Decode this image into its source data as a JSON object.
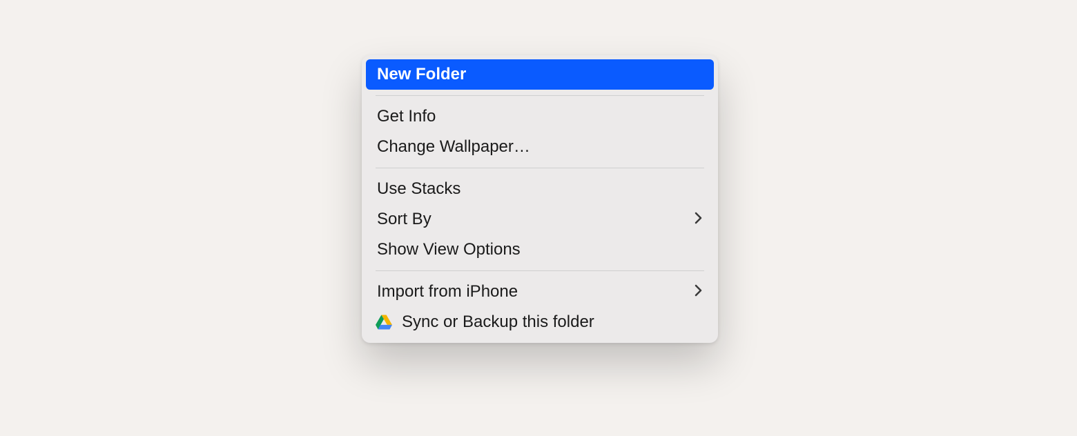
{
  "menu": {
    "items": [
      {
        "label": "New Folder"
      },
      {
        "label": "Get Info"
      },
      {
        "label": "Change Wallpaper…"
      },
      {
        "label": "Use Stacks"
      },
      {
        "label": "Sort By"
      },
      {
        "label": "Show View Options"
      },
      {
        "label": "Import from iPhone"
      },
      {
        "label": "Sync or Backup this folder"
      }
    ]
  }
}
